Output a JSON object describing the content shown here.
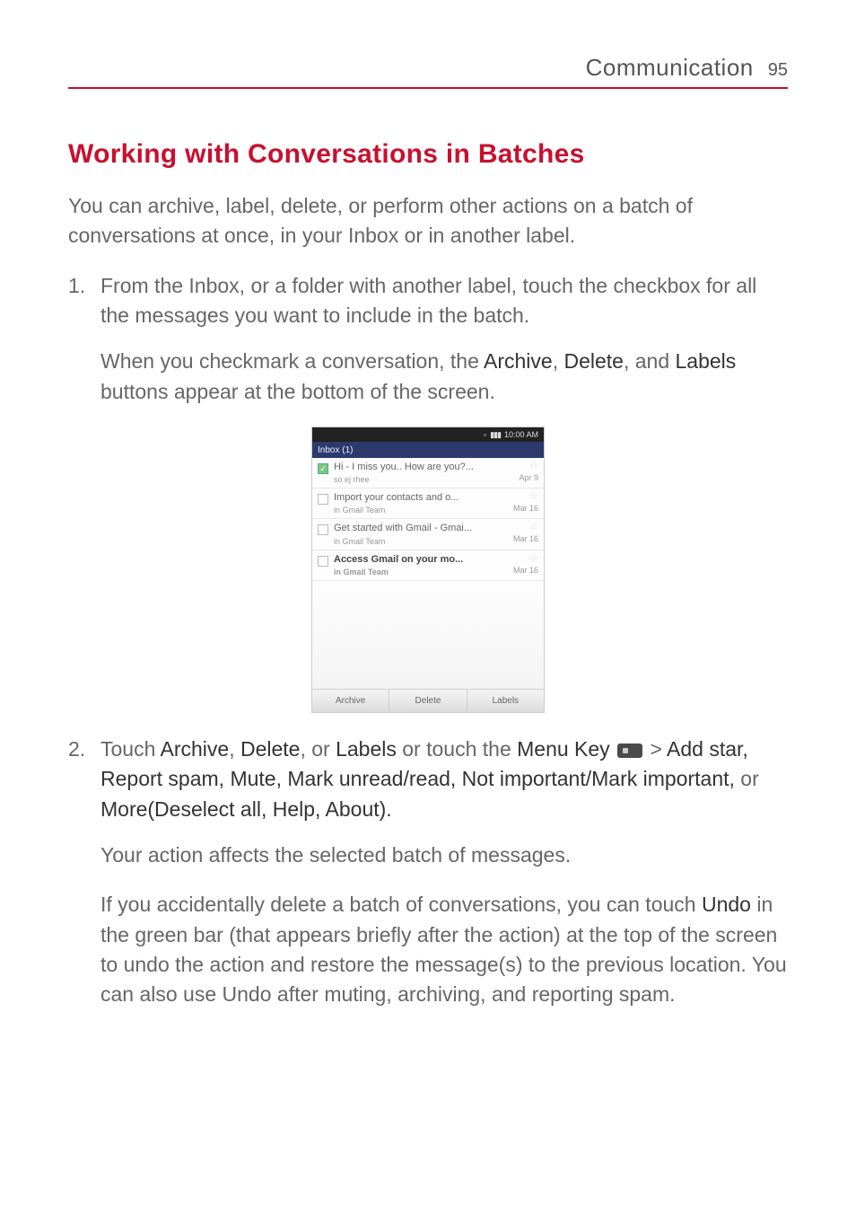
{
  "header": {
    "chapter": "Communication",
    "page_number": "95"
  },
  "section_title": "Working with Conversations in Batches",
  "intro": "You can archive, label, delete, or perform other actions on a batch of conversations at once, in your Inbox or in another label.",
  "step1_num": "1.",
  "step1": "From the Inbox, or a folder with another label, touch the checkbox for all the messages you want to include in the batch.",
  "step1_sub_pre": "When you checkmark a conversation, the ",
  "term_archive": "Archive",
  "sep1": ", ",
  "term_delete": "Delete",
  "sep2": ", and ",
  "term_labels": "Labels",
  "step1_sub_post": " buttons appear at the bottom of the screen.",
  "screenshot": {
    "status_time": "10:00 AM",
    "inbox_label": "Inbox (1)",
    "rows": [
      {
        "checked": true,
        "subject": "Hi - I miss you.. How are you?...",
        "from": "so ej rhee",
        "date": "Apr 9",
        "unread": false
      },
      {
        "checked": false,
        "subject": "Import your contacts and o...",
        "from": "in Gmail Team",
        "date": "Mar 16",
        "unread": false
      },
      {
        "checked": false,
        "subject": "Get started with Gmail - Gmai...",
        "from": "in Gmail Team",
        "date": "Mar 16",
        "unread": false
      },
      {
        "checked": false,
        "subject": "Access Gmail on your mo...",
        "from": "in Gmail Team",
        "date": "Mar 16",
        "unread": true
      }
    ],
    "buttons": {
      "archive": "Archive",
      "delete": "Delete",
      "labels": "Labels"
    }
  },
  "step2_num": "2.",
  "step2_a": "Touch ",
  "step2_archive": "Archive",
  "step2_b": ", ",
  "step2_delete": "Delete",
  "step2_c": ", or ",
  "step2_labels": "Labels",
  "step2_d": " or touch the ",
  "step2_menukey": "Menu Key",
  "step2_e": " > ",
  "step2_bold_rest": "Add star, Report spam, Mute, Mark unread/read, Not important/Mark important,",
  "step2_or": " or ",
  "step2_more": "More(Deselect all, Help, About).",
  "step2_sub1": "Your action affects the selected batch of messages.",
  "step2_sub2_a": "If you accidentally delete a batch of conversations, you can touch ",
  "step2_undo": "Undo",
  "step2_sub2_b": " in the green bar (that appears briefly after the action) at the top of the screen to undo the action and restore the message(s) to the previous location. You can also use Undo after muting, archiving, and reporting spam."
}
